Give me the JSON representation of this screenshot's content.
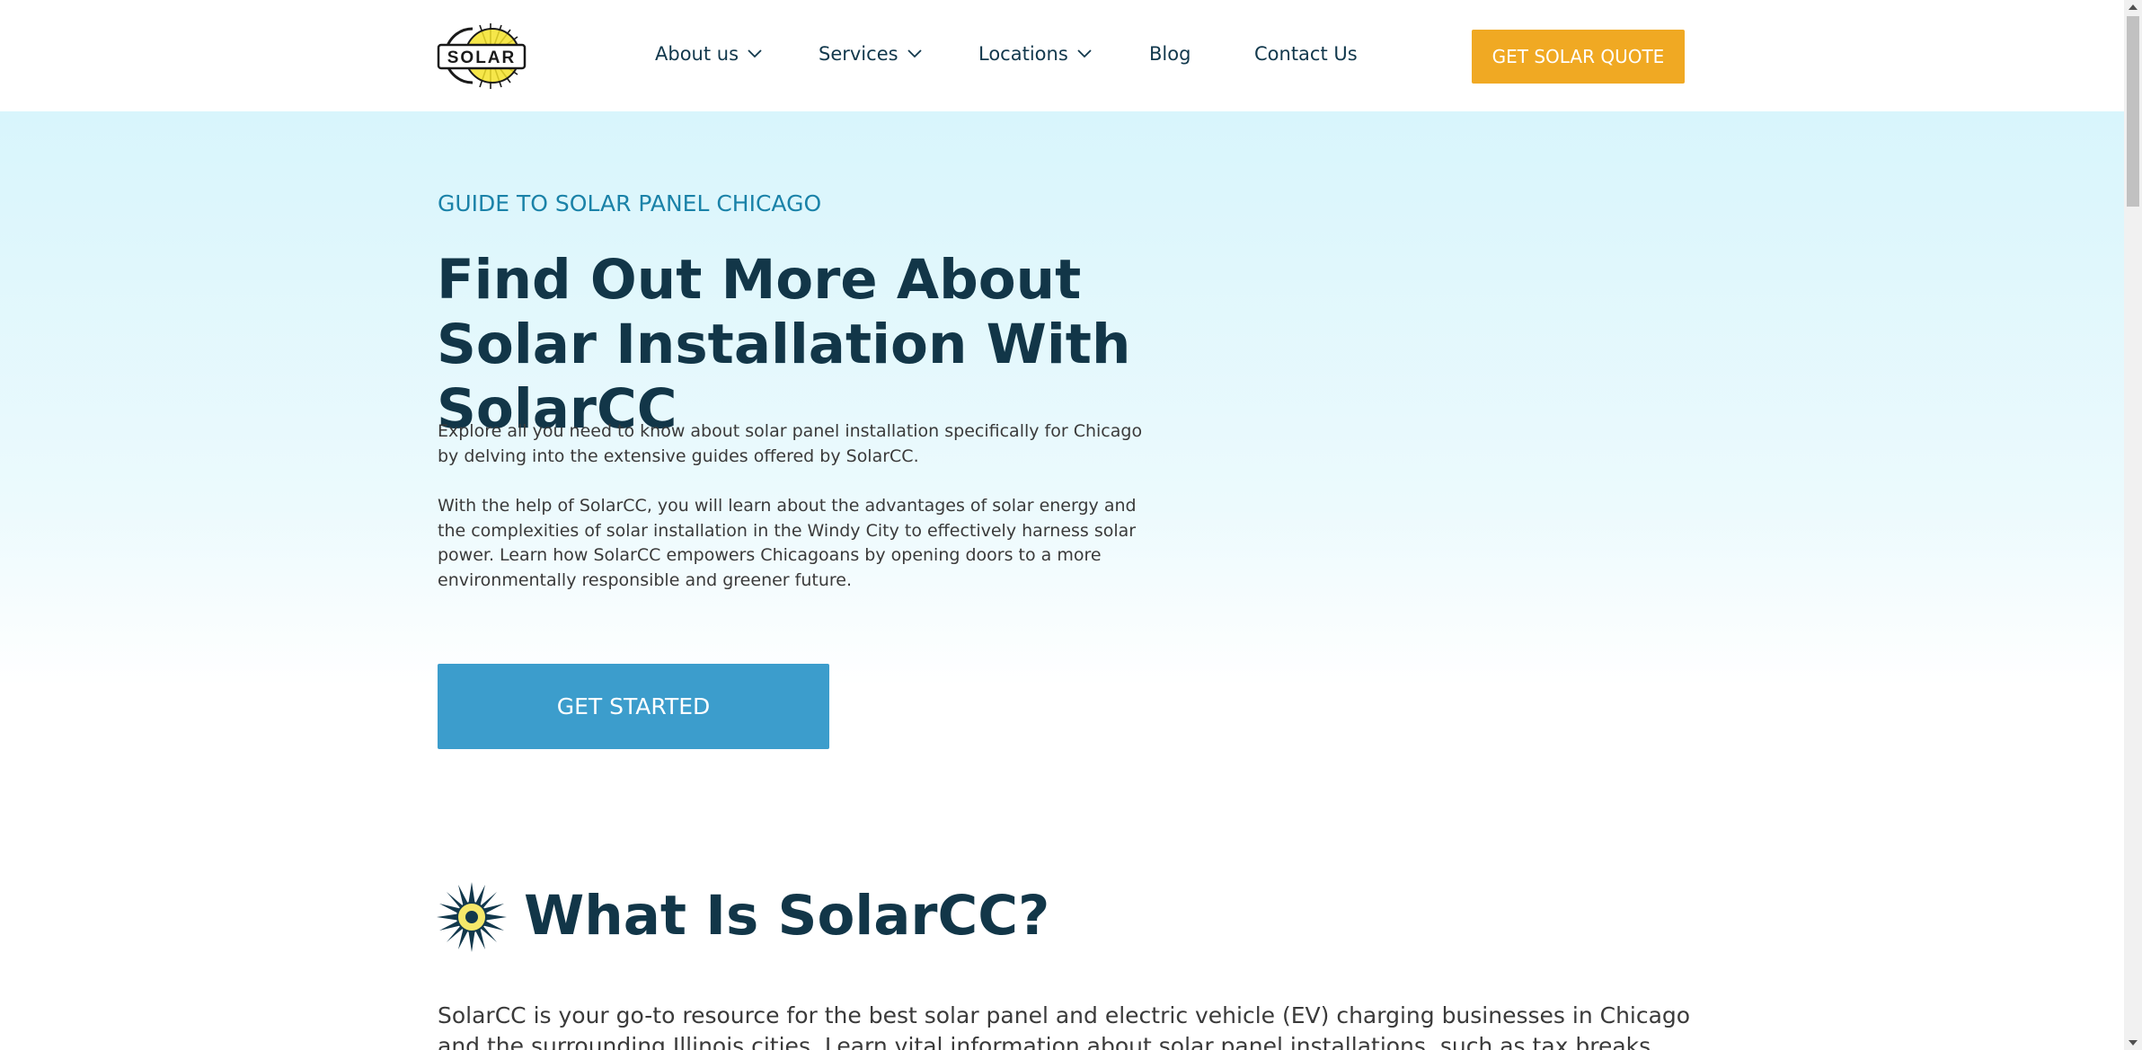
{
  "header": {
    "logo_text": "SOLAR",
    "nav": [
      {
        "label": "About us",
        "has_dropdown": true
      },
      {
        "label": "Services",
        "has_dropdown": true
      },
      {
        "label": "Locations",
        "has_dropdown": true
      },
      {
        "label": "Blog",
        "has_dropdown": false
      },
      {
        "label": "Contact Us",
        "has_dropdown": false
      }
    ],
    "cta_label": "GET SOLAR QUOTE"
  },
  "hero": {
    "eyebrow": "GUIDE TO SOLAR PANEL CHICAGO",
    "title": "Find Out More About Solar Installation With SolarCC",
    "paragraphs": [
      "Explore all you need to know about solar panel installation specifically for Chicago by delving into the extensive guides offered by SolarCC.",
      "With the help of SolarCC, you will learn about the advantages of solar energy and the complexities of solar installation in the Windy City to effectively harness solar power. Learn how SolarCC empowers Chicagoans by opening doors to a more environmentally responsible and greener future."
    ],
    "button_label": "GET STARTED"
  },
  "section": {
    "icon": "sun-icon",
    "title": "What Is SolarCC?",
    "paragraph": "SolarCC is your go-to resource for the best solar panel and electric vehicle (EV) charging businesses in Chicago and the surrounding Illinois cities. Learn vital information about solar panel installations, such as tax breaks, special features"
  },
  "colors": {
    "accent_orange": "#f0a923",
    "accent_blue": "#3c9dcc",
    "eyebrow_blue": "#1a82a8",
    "heading": "#123648"
  }
}
